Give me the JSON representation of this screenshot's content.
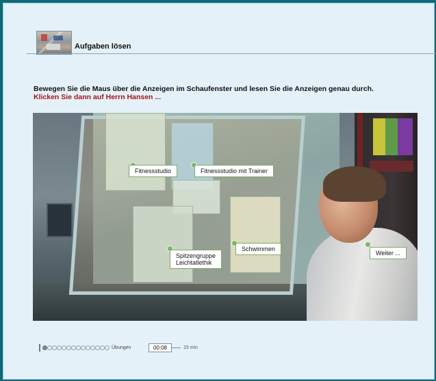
{
  "header": {
    "title": "Aufgaben lösen"
  },
  "instructions": {
    "line1": "Bewegen Sie die Maus über die Anzeigen im Schaufenster und lesen Sie die Anzeigen genau durch.",
    "line2": "Klicken Sie dann auf Herrn Hansen ..."
  },
  "hotspots": [
    {
      "label": "Fitnessstudio"
    },
    {
      "label": "Fitnessstudio mit Trainer"
    },
    {
      "label": "Spitzengruppe\nLeichtatlethik"
    },
    {
      "label": "Schwimmen"
    },
    {
      "label": "Weiter ..."
    }
  ],
  "progress": {
    "label": "Übungen",
    "steps_total": 14,
    "steps_done": 1,
    "timer": "00:08",
    "limit": "15 min"
  },
  "colors": {
    "accent_red": "#a3161b",
    "hotspot_green": "#7ab86a",
    "frame_teal": "#0c6a78"
  }
}
